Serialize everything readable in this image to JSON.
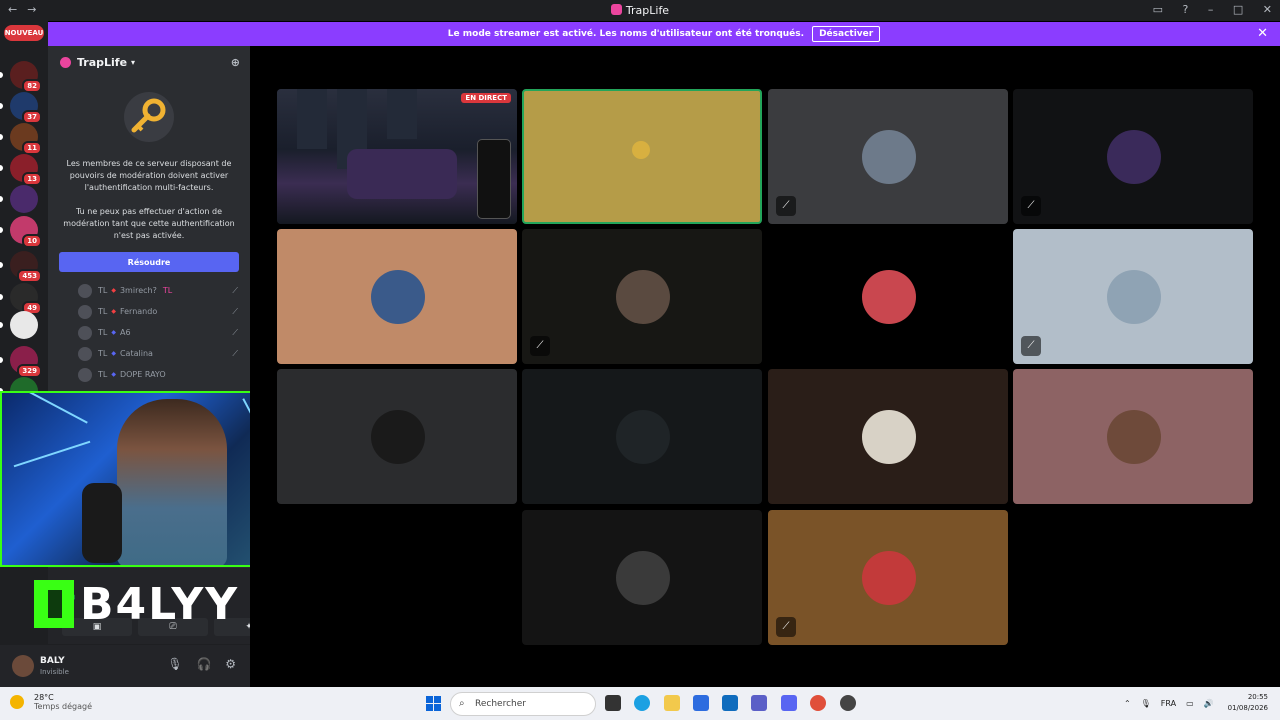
{
  "window": {
    "title": "TrapLife"
  },
  "banner": {
    "message": "Le mode streamer est activé. Les noms d'utilisateur ont été tronqués.",
    "button": "Désactiver"
  },
  "rail": {
    "new_label": "NOUVEAU",
    "servers": [
      {
        "badge": "82",
        "color": "#5a1f1f"
      },
      {
        "badge": "37",
        "color": "#1f3a6b"
      },
      {
        "badge": "11",
        "color": "#6b3a1f"
      },
      {
        "badge": "13",
        "color": "#8a1f2a"
      },
      {
        "badge": "",
        "color": "#4a2a6b"
      },
      {
        "badge": "10",
        "color": "#c23a6b"
      },
      {
        "badge": "453",
        "color": "#3a1f1f"
      },
      {
        "badge": "49",
        "color": "#2a2a2a"
      },
      {
        "badge": "",
        "color": "#e8e8e8"
      },
      {
        "badge": "329",
        "color": "#8a1f4a"
      },
      {
        "badge": "",
        "color": "#1f6b2a"
      }
    ]
  },
  "sidebar": {
    "server_name": "TrapLife",
    "mfa": {
      "text1": "Les membres de ce serveur disposant de pouvoirs de modération doivent activer l'authentification multi-facteurs.",
      "text2": "Tu ne peux pas effectuer d'action de modération tant que cette authentification n'est pas activée.",
      "button": "Résoudre"
    },
    "members": [
      {
        "tag": "TL",
        "name": "3mirech?",
        "extra": "TL",
        "sep": "red"
      },
      {
        "tag": "TL",
        "name": "Fernando",
        "sep": "red"
      },
      {
        "tag": "TL",
        "name": "A6",
        "sep": "blue"
      },
      {
        "tag": "TL",
        "name": "Catalina",
        "sep": "blue"
      },
      {
        "tag": "TL",
        "name": "DOPE RAYO",
        "sep": "blue"
      }
    ]
  },
  "overlay": {
    "streamer_logo": "B4LYY"
  },
  "user": {
    "name": "BALY",
    "status": "Invisible"
  },
  "stage": {
    "live_label": "EN DIRECT",
    "tiles": [
      {
        "bg": "#1c2030",
        "kind": "stream"
      },
      {
        "bg": "#b59c48",
        "kind": "speaking"
      },
      {
        "bg": "#3b3c3f",
        "avatar": "#6d7a8a",
        "muted": true
      },
      {
        "bg": "#111214",
        "avatar": "#3a2a5a",
        "muted": true
      },
      {
        "bg": "#c08a68",
        "avatar": "#3a5a8a",
        "muted": false
      },
      {
        "bg": "#171714",
        "avatar": "#5a4a40",
        "muted": true
      },
      {
        "bg": "#000000",
        "avatar": "#c9474f",
        "muted": false
      },
      {
        "bg": "#b2bec9",
        "avatar": "#8fa3b4",
        "muted": true
      },
      {
        "bg": "#2b2c2e",
        "avatar": "#1a1a1a",
        "muted": false
      },
      {
        "bg": "#15181a",
        "avatar": "#1f2427",
        "muted": false
      },
      {
        "bg": "#2a1e18",
        "avatar": "#d8d2c6",
        "muted": false
      },
      {
        "bg": "#8d6364",
        "avatar": "#6e4a3a",
        "muted": false
      },
      {
        "bg": "#141414",
        "avatar": "#3a3a3a",
        "muted": false
      },
      {
        "bg": "#7a5328",
        "avatar": "#c23a3a",
        "muted": true
      }
    ]
  },
  "taskbar": {
    "weather_temp": "28°C",
    "weather_desc": "Temps dégagé",
    "search_placeholder": "Rechercher",
    "lang": "FRA",
    "time": "20:55",
    "date": "01/08/2026"
  },
  "icons": {
    "key": "key-icon",
    "mute": "mic-off-icon",
    "mic": "mic-icon",
    "headset": "headset-icon",
    "settings": "gear-icon",
    "add_member": "add-user-icon",
    "close": "close-icon"
  }
}
